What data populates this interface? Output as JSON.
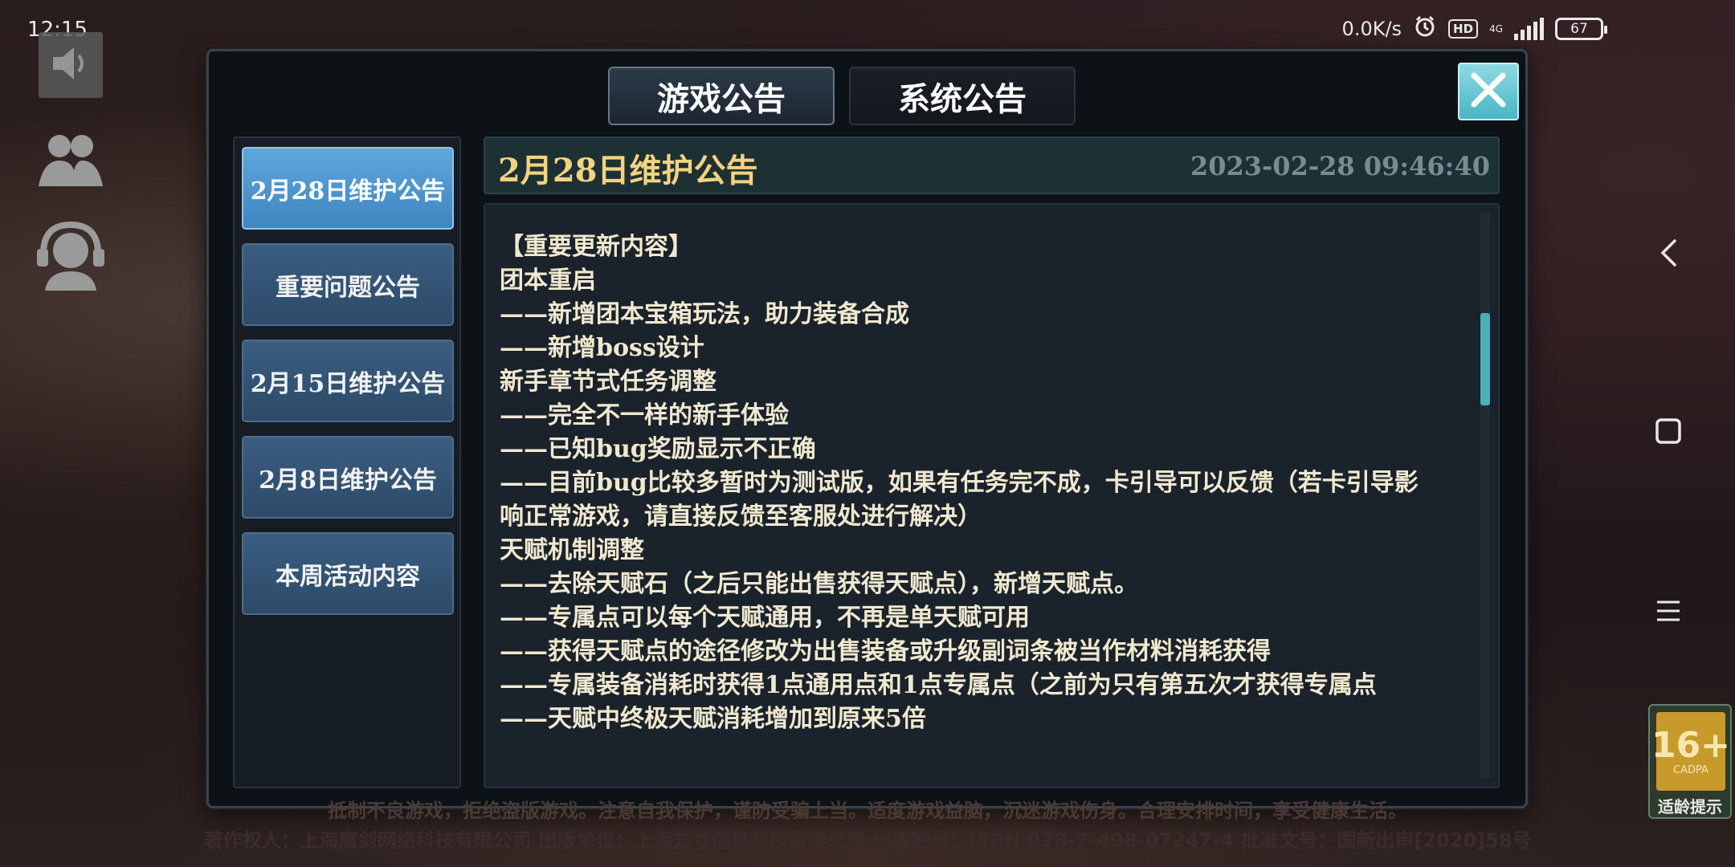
{
  "status_bar": {
    "time": "12:15",
    "net_speed": "0.0K/s",
    "hd_badge": "HD",
    "network": "4G",
    "battery": "67"
  },
  "tabs": [
    {
      "label": "游戏公告",
      "active": true
    },
    {
      "label": "系统公告",
      "active": false
    }
  ],
  "sidebar": {
    "items": [
      {
        "label": "2月28日维护公告",
        "active": true
      },
      {
        "label": "重要问题公告",
        "active": false
      },
      {
        "label": "2月15日维护公告",
        "active": false
      },
      {
        "label": "2月8日维护公告",
        "active": false
      },
      {
        "label": "本周活动内容",
        "active": false
      }
    ]
  },
  "notice": {
    "title": "2月28日维护公告",
    "date": "2023-02-28  09:46:40",
    "lines": [
      "【重要更新内容】",
      "团本重启",
      "——新增团本宝箱玩法，助力装备合成",
      "——新增boss设计",
      "新手章节式任务调整",
      "——完全不一样的新手体验",
      "——已知bug奖励显示不正确",
      "——目前bug比较多暂时为测试版，如果有任务完不成，卡引导可以反馈（若卡引导影",
      "响正常游戏，请直接反馈至客服处进行解决）",
      "天赋机制调整",
      "——去除天赋石（之后只能出售获得天赋点），新增天赋点。",
      "——专属点可以每个天赋通用，不再是单天赋可用",
      "——获得天赋点的途径修改为出售装备或升级副词条被当作材料消耗获得",
      "——专属装备消耗时获得1点通用点和1点专属点（之前为只有第五次才获得专属点",
      "——天赋中终极天赋消耗增加到原来5倍"
    ]
  },
  "footer": {
    "line1": "抵制不良游戏，拒绝盗版游戏。注意自我保护，谨防受骗上当。适度游戏益脑，沉迷游戏伤身。合理安排时间，享受健康生活。",
    "line2": "著作权人：上海魔剑网络科技有限公司 出版单位：上海方寸信息科技有限公司 出版物号：ISBN 978-7-498-07247-4 批准文号：国新出审[2020]58号"
  },
  "age_rating": {
    "number": "16+",
    "org": "CADPA",
    "label": "适龄提示"
  },
  "colors": {
    "accent_gold": "#f3d37e",
    "active_tab_blue": "#5fa6db",
    "close_button": "#49b5c5"
  }
}
